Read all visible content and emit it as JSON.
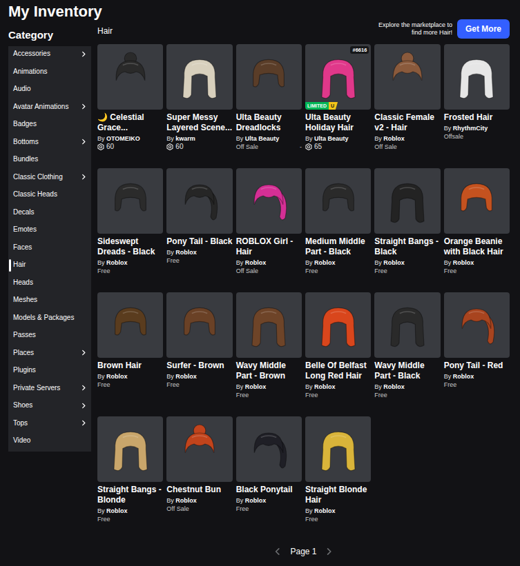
{
  "page": {
    "title": "My Inventory"
  },
  "sidebar": {
    "heading": "Category",
    "items": [
      {
        "label": "Accessories",
        "selected": false,
        "expandable": true
      },
      {
        "label": "Animations",
        "selected": false,
        "expandable": false
      },
      {
        "label": "Audio",
        "selected": false,
        "expandable": false
      },
      {
        "label": "Avatar Animations",
        "selected": false,
        "expandable": true
      },
      {
        "label": "Badges",
        "selected": false,
        "expandable": false
      },
      {
        "label": "Bottoms",
        "selected": false,
        "expandable": true
      },
      {
        "label": "Bundles",
        "selected": false,
        "expandable": false
      },
      {
        "label": "Classic Clothing",
        "selected": false,
        "expandable": true
      },
      {
        "label": "Classic Heads",
        "selected": false,
        "expandable": false
      },
      {
        "label": "Decals",
        "selected": false,
        "expandable": false
      },
      {
        "label": "Emotes",
        "selected": false,
        "expandable": false
      },
      {
        "label": "Faces",
        "selected": false,
        "expandable": false
      },
      {
        "label": "Hair",
        "selected": true,
        "expandable": false
      },
      {
        "label": "Heads",
        "selected": false,
        "expandable": false
      },
      {
        "label": "Meshes",
        "selected": false,
        "expandable": false
      },
      {
        "label": "Models & Packages",
        "selected": false,
        "expandable": false
      },
      {
        "label": "Passes",
        "selected": false,
        "expandable": false
      },
      {
        "label": "Places",
        "selected": false,
        "expandable": true
      },
      {
        "label": "Plugins",
        "selected": false,
        "expandable": false
      },
      {
        "label": "Private Servers",
        "selected": false,
        "expandable": true
      },
      {
        "label": "Shoes",
        "selected": false,
        "expandable": true
      },
      {
        "label": "Tops",
        "selected": false,
        "expandable": true
      },
      {
        "label": "Video",
        "selected": false,
        "expandable": false
      }
    ]
  },
  "section": {
    "label": "Hair",
    "explore_text": "Explore the marketplace to find more Hair!",
    "button": "Get More"
  },
  "creator_prefix": "By",
  "items": [
    {
      "name": "🌙 Celestial Grace...",
      "creator": "OTOMEIKO",
      "price": "60",
      "kind": "bun",
      "color": "#2a2a2a"
    },
    {
      "name": "Super Messy Layered Scene...",
      "creator": "kwarm",
      "price": "60",
      "kind": "long",
      "color": "#d8d0bd"
    },
    {
      "name": "Ulta Beauty Dreadlocks",
      "creator": "Ulta Beauty",
      "status": "Off Sale",
      "trailing": "-",
      "kind": "short",
      "color": "#5a3d28"
    },
    {
      "name": "Ulta Beauty Holiday Hair",
      "creator": "Ulta Beauty",
      "price": "65",
      "kind": "long",
      "color": "#e0388a",
      "limited": {
        "label": "LIMITED",
        "tag": "U"
      },
      "serial": "#6616"
    },
    {
      "name": "Classic Female v2 - Hair",
      "creator": "Roblox",
      "status": "Off Sale",
      "kind": "bun",
      "color": "#8a5a3c"
    },
    {
      "name": "Frosted Hair",
      "creator": "RhythmCity",
      "status": "Offsale",
      "kind": "long",
      "color": "#e6e6e6"
    },
    {
      "name": "Sideswept Dreads - Black",
      "creator": "Roblox",
      "status": "Free",
      "kind": "short",
      "color": "#2b2b2b"
    },
    {
      "name": "Pony Tail - Black",
      "creator": "Roblox",
      "status": "Free",
      "kind": "ponytail",
      "color": "#262626"
    },
    {
      "name": "ROBLOX Girl - Hair",
      "creator": "Roblox",
      "status": "Off Sale",
      "kind": "ponytail",
      "color": "#d52f95"
    },
    {
      "name": "Medium Middle Part - Black",
      "creator": "Roblox",
      "status": "Free",
      "kind": "short",
      "color": "#2a2a2a"
    },
    {
      "name": "Straight Bangs - Black",
      "creator": "Roblox",
      "status": "Free",
      "kind": "long",
      "color": "#232323"
    },
    {
      "name": "Orange Beanie with Black Hair",
      "creator": "Roblox",
      "status": "Free",
      "kind": "short",
      "color": "#c4521f"
    },
    {
      "name": "Brown Hair",
      "creator": "Roblox",
      "status": "Free",
      "kind": "short",
      "color": "#5a3c1e"
    },
    {
      "name": "Surfer - Brown",
      "creator": "Roblox",
      "status": "Free",
      "kind": "short",
      "color": "#6a4126"
    },
    {
      "name": "Wavy Middle Part - Brown",
      "creator": "Roblox",
      "status": "Free",
      "kind": "long",
      "color": "#6e4428"
    },
    {
      "name": "Belle Of Belfast Long Red Hair",
      "creator": "Roblox",
      "status": "Free",
      "kind": "long",
      "color": "#d9461c"
    },
    {
      "name": "Wavy Middle Part - Black",
      "creator": "Roblox",
      "status": "Free",
      "kind": "long",
      "color": "#2a2a2a"
    },
    {
      "name": "Pony Tail - Red",
      "creator": "Roblox",
      "status": "Free",
      "kind": "ponytail",
      "color": "#a8441f"
    },
    {
      "name": "Straight Bangs - Blonde",
      "creator": "Roblox",
      "status": "Free",
      "kind": "long",
      "color": "#c9a66b"
    },
    {
      "name": "Chestnut Bun",
      "creator": "Roblox",
      "status": "Off Sale",
      "kind": "bun",
      "color": "#c2441c"
    },
    {
      "name": "Black Ponytail",
      "creator": "Roblox",
      "status": "Free",
      "kind": "ponytail",
      "color": "#1f1f26"
    },
    {
      "name": "Straight Blonde Hair",
      "creator": "Roblox",
      "status": "Free",
      "kind": "long",
      "color": "#d9b43a"
    }
  ],
  "pagination": {
    "label": "Page 1",
    "prev_disabled": true,
    "next_disabled": true
  }
}
